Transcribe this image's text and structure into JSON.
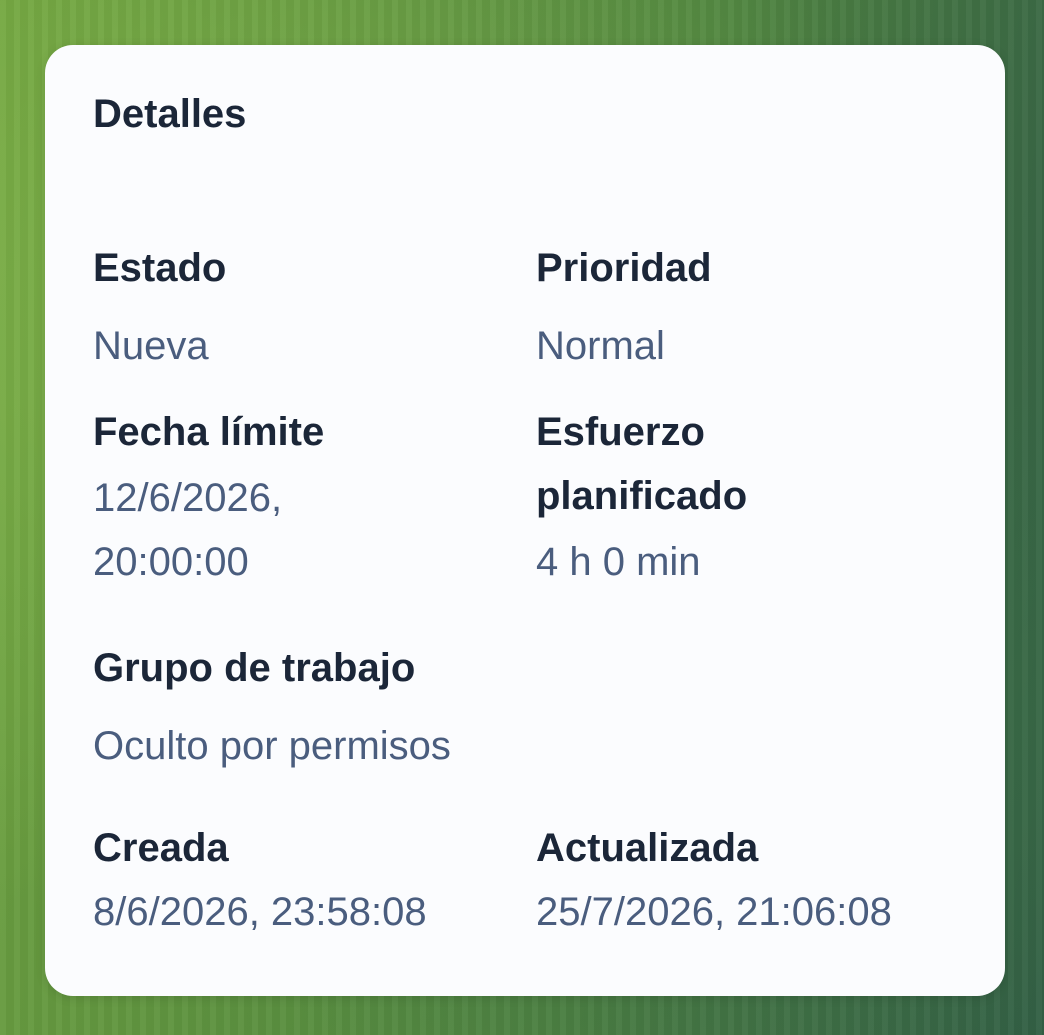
{
  "card": {
    "title": "Detalles",
    "fields": {
      "estado": {
        "label": "Estado",
        "value": "Nueva"
      },
      "prioridad": {
        "label": "Prioridad",
        "value": "Normal"
      },
      "fecha_limite": {
        "label": "Fecha límite",
        "value_line1": "12/6/2026,",
        "value_line2": "20:00:00"
      },
      "esfuerzo": {
        "label_line1": "Esfuerzo",
        "label_line2": "planificado",
        "value": "4 h 0 min"
      },
      "grupo": {
        "label": "Grupo de trabajo",
        "value": "Oculto por permisos"
      },
      "creada": {
        "label": "Creada",
        "value": "8/6/2026, 23:58:08"
      },
      "actualizada": {
        "label": "Actualizada",
        "value": "25/7/2026, 21:06:08"
      }
    }
  }
}
